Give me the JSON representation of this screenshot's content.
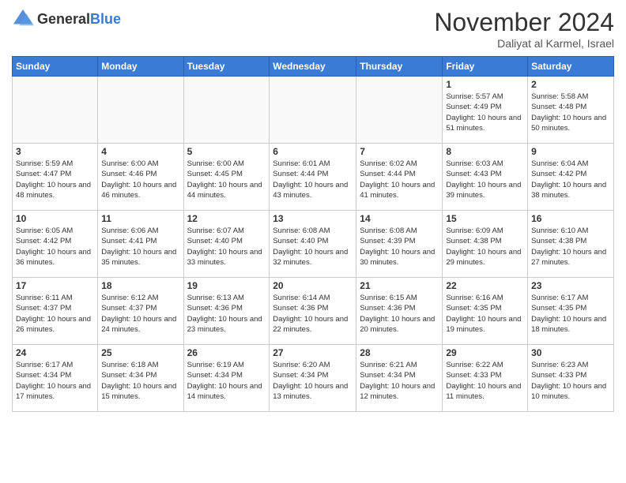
{
  "header": {
    "logo": {
      "general": "General",
      "blue": "Blue"
    },
    "title": "November 2024",
    "location": "Daliyat al Karmel, Israel"
  },
  "calendar": {
    "days_of_week": [
      "Sunday",
      "Monday",
      "Tuesday",
      "Wednesday",
      "Thursday",
      "Friday",
      "Saturday"
    ],
    "weeks": [
      [
        {
          "day": "",
          "info": ""
        },
        {
          "day": "",
          "info": ""
        },
        {
          "day": "",
          "info": ""
        },
        {
          "day": "",
          "info": ""
        },
        {
          "day": "",
          "info": ""
        },
        {
          "day": "1",
          "info": "Sunrise: 5:57 AM\nSunset: 4:49 PM\nDaylight: 10 hours and 51 minutes."
        },
        {
          "day": "2",
          "info": "Sunrise: 5:58 AM\nSunset: 4:48 PM\nDaylight: 10 hours and 50 minutes."
        }
      ],
      [
        {
          "day": "3",
          "info": "Sunrise: 5:59 AM\nSunset: 4:47 PM\nDaylight: 10 hours and 48 minutes."
        },
        {
          "day": "4",
          "info": "Sunrise: 6:00 AM\nSunset: 4:46 PM\nDaylight: 10 hours and 46 minutes."
        },
        {
          "day": "5",
          "info": "Sunrise: 6:00 AM\nSunset: 4:45 PM\nDaylight: 10 hours and 44 minutes."
        },
        {
          "day": "6",
          "info": "Sunrise: 6:01 AM\nSunset: 4:44 PM\nDaylight: 10 hours and 43 minutes."
        },
        {
          "day": "7",
          "info": "Sunrise: 6:02 AM\nSunset: 4:44 PM\nDaylight: 10 hours and 41 minutes."
        },
        {
          "day": "8",
          "info": "Sunrise: 6:03 AM\nSunset: 4:43 PM\nDaylight: 10 hours and 39 minutes."
        },
        {
          "day": "9",
          "info": "Sunrise: 6:04 AM\nSunset: 4:42 PM\nDaylight: 10 hours and 38 minutes."
        }
      ],
      [
        {
          "day": "10",
          "info": "Sunrise: 6:05 AM\nSunset: 4:42 PM\nDaylight: 10 hours and 36 minutes."
        },
        {
          "day": "11",
          "info": "Sunrise: 6:06 AM\nSunset: 4:41 PM\nDaylight: 10 hours and 35 minutes."
        },
        {
          "day": "12",
          "info": "Sunrise: 6:07 AM\nSunset: 4:40 PM\nDaylight: 10 hours and 33 minutes."
        },
        {
          "day": "13",
          "info": "Sunrise: 6:08 AM\nSunset: 4:40 PM\nDaylight: 10 hours and 32 minutes."
        },
        {
          "day": "14",
          "info": "Sunrise: 6:08 AM\nSunset: 4:39 PM\nDaylight: 10 hours and 30 minutes."
        },
        {
          "day": "15",
          "info": "Sunrise: 6:09 AM\nSunset: 4:38 PM\nDaylight: 10 hours and 29 minutes."
        },
        {
          "day": "16",
          "info": "Sunrise: 6:10 AM\nSunset: 4:38 PM\nDaylight: 10 hours and 27 minutes."
        }
      ],
      [
        {
          "day": "17",
          "info": "Sunrise: 6:11 AM\nSunset: 4:37 PM\nDaylight: 10 hours and 26 minutes."
        },
        {
          "day": "18",
          "info": "Sunrise: 6:12 AM\nSunset: 4:37 PM\nDaylight: 10 hours and 24 minutes."
        },
        {
          "day": "19",
          "info": "Sunrise: 6:13 AM\nSunset: 4:36 PM\nDaylight: 10 hours and 23 minutes."
        },
        {
          "day": "20",
          "info": "Sunrise: 6:14 AM\nSunset: 4:36 PM\nDaylight: 10 hours and 22 minutes."
        },
        {
          "day": "21",
          "info": "Sunrise: 6:15 AM\nSunset: 4:36 PM\nDaylight: 10 hours and 20 minutes."
        },
        {
          "day": "22",
          "info": "Sunrise: 6:16 AM\nSunset: 4:35 PM\nDaylight: 10 hours and 19 minutes."
        },
        {
          "day": "23",
          "info": "Sunrise: 6:17 AM\nSunset: 4:35 PM\nDaylight: 10 hours and 18 minutes."
        }
      ],
      [
        {
          "day": "24",
          "info": "Sunrise: 6:17 AM\nSunset: 4:34 PM\nDaylight: 10 hours and 17 minutes."
        },
        {
          "day": "25",
          "info": "Sunrise: 6:18 AM\nSunset: 4:34 PM\nDaylight: 10 hours and 15 minutes."
        },
        {
          "day": "26",
          "info": "Sunrise: 6:19 AM\nSunset: 4:34 PM\nDaylight: 10 hours and 14 minutes."
        },
        {
          "day": "27",
          "info": "Sunrise: 6:20 AM\nSunset: 4:34 PM\nDaylight: 10 hours and 13 minutes."
        },
        {
          "day": "28",
          "info": "Sunrise: 6:21 AM\nSunset: 4:34 PM\nDaylight: 10 hours and 12 minutes."
        },
        {
          "day": "29",
          "info": "Sunrise: 6:22 AM\nSunset: 4:33 PM\nDaylight: 10 hours and 11 minutes."
        },
        {
          "day": "30",
          "info": "Sunrise: 6:23 AM\nSunset: 4:33 PM\nDaylight: 10 hours and 10 minutes."
        }
      ]
    ]
  }
}
